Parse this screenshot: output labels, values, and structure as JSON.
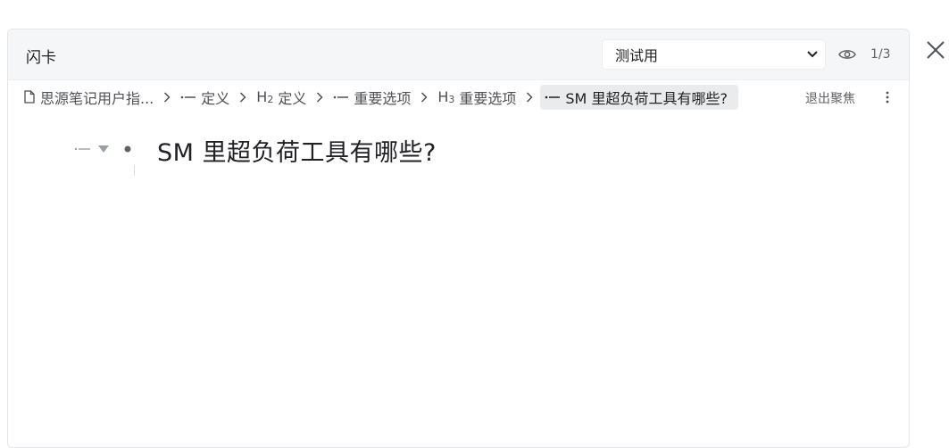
{
  "dialog": {
    "title": "闪卡",
    "deck_select": {
      "selected": "测试用"
    },
    "counter": "1/3"
  },
  "breadcrumb": {
    "items": [
      {
        "icon": "document-icon",
        "label": "思源笔记用户指..."
      },
      {
        "icon": "list-item-icon",
        "label": "定义"
      },
      {
        "icon": "heading-2-icon",
        "prefix": "H",
        "level": "2",
        "label": "定义"
      },
      {
        "icon": "list-item-icon",
        "label": "重要选项"
      },
      {
        "icon": "heading-3-icon",
        "prefix": "H",
        "level": "3",
        "label": "重要选项"
      },
      {
        "icon": "list-item-icon",
        "label": "SM 里超负荷工具有哪些?"
      }
    ],
    "exit_focus_label": "退出聚焦"
  },
  "card": {
    "heading": "SM 里超负荷工具有哪些?"
  },
  "colors": {
    "header_bg": "#f5f6f7",
    "active_crumb_bg": "#e9ebed",
    "text": "#202124",
    "muted": "#5f6368"
  }
}
